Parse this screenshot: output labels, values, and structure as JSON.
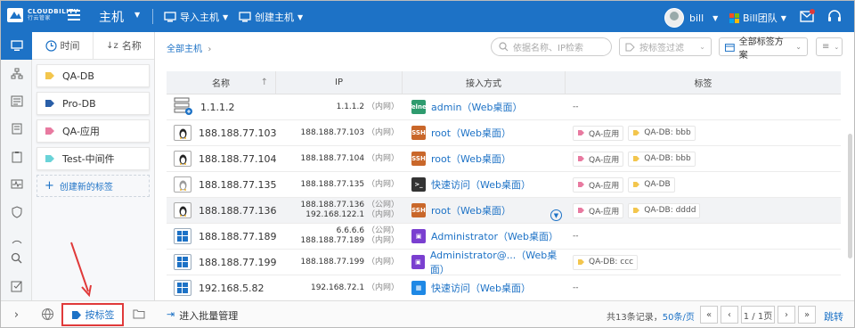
{
  "brand": {
    "name": "CLOUDBILITY",
    "sub": "行云管家"
  },
  "topbar": {
    "title": "主机",
    "import": "导入主机",
    "create": "创建主机",
    "user": "bill",
    "team": "Bill团队"
  },
  "colors": {
    "primary": "#1d72c6",
    "red": "#e03a3a"
  },
  "tagpanel": {
    "sort_time": "时间",
    "sort_name": "名称",
    "new_tag": "创建新的标签",
    "tags": [
      {
        "label": "QA-DB",
        "color": "#f3c64d"
      },
      {
        "label": "Pro-DB",
        "color": "#2a5fa8"
      },
      {
        "label": "QA-应用",
        "color": "#e87aa0"
      },
      {
        "label": "Test-中间件",
        "color": "#6ad3d8"
      }
    ]
  },
  "main": {
    "breadcrumb": "全部主机",
    "search_placeholder": "依据名称、IP检索",
    "tag_filter": "按标签过滤",
    "tag_scheme": "全部标签方案",
    "columns": {
      "name": "名称",
      "ip": "IP",
      "access": "接入方式",
      "tags": "标签"
    },
    "rows": [
      {
        "name": "1.1.1.2",
        "os": "server",
        "ips": [
          {
            "ip": "1.1.1.2",
            "net": "（内网）"
          }
        ],
        "acc_icon": "Telnet",
        "acc_color": "#2e9b6e",
        "access": "admin（Web桌面）",
        "tags": [],
        "empty": "--"
      },
      {
        "name": "188.188.77.103",
        "os": "linux",
        "ips": [
          {
            "ip": "188.188.77.103",
            "net": "（内网）"
          }
        ],
        "acc_icon": "SSH",
        "acc_color": "#c9672a",
        "access": "root（Web桌面）",
        "tags": [
          "QA-应用",
          "QA-DB: bbb"
        ]
      },
      {
        "name": "188.188.77.104",
        "os": "linux",
        "ips": [
          {
            "ip": "188.188.77.104",
            "net": "（内网）"
          }
        ],
        "acc_icon": "SSH",
        "acc_color": "#c9672a",
        "access": "root（Web桌面）",
        "tags": [
          "QA-应用",
          "QA-DB: bbb"
        ]
      },
      {
        "name": "188.188.77.135",
        "os": "linux-grey",
        "ips": [
          {
            "ip": "188.188.77.135",
            "net": "（内网）"
          }
        ],
        "acc_icon": ">_",
        "acc_color": "#333",
        "access": "快速访问（Web桌面）",
        "tags": [
          "QA-应用",
          "QA-DB"
        ]
      },
      {
        "name": "188.188.77.136",
        "os": "linux",
        "ips": [
          {
            "ip": "188.188.77.136",
            "net": "（公网）"
          },
          {
            "ip": "192.168.122.1",
            "net": "（内网）"
          }
        ],
        "acc_icon": "SSH",
        "acc_color": "#c9672a",
        "access": "root（Web桌面）",
        "tags": [
          "QA-应用",
          "QA-DB: dddd"
        ]
      },
      {
        "name": "188.188.77.189",
        "os": "windows",
        "ips": [
          {
            "ip": "6.6.6.6",
            "net": "（公网）"
          },
          {
            "ip": "188.188.77.189",
            "net": "（内网）"
          }
        ],
        "acc_icon": "RDP",
        "acc_color": "#7a3fd0",
        "access": "Administrator（Web桌面）",
        "tags": [],
        "empty": "--"
      },
      {
        "name": "188.188.77.199",
        "os": "windows",
        "ips": [
          {
            "ip": "188.188.77.199",
            "net": "（内网）"
          }
        ],
        "acc_icon": "RDP",
        "acc_color": "#7a3fd0",
        "access": "Administrator@...（Web桌面）",
        "tags": [
          "QA-DB: ccc"
        ]
      },
      {
        "name": "192.168.5.82",
        "os": "windows",
        "ips": [
          {
            "ip": "192.168.72.1",
            "net": "（内网）"
          }
        ],
        "acc_icon": "WIN",
        "acc_color": "#1e88e5",
        "access": "快速访问（Web桌面）",
        "tags": [],
        "empty": "--"
      }
    ]
  },
  "bottom": {
    "bytag": "按标签",
    "batch": "进入批量管理",
    "total": "共13条记录，",
    "per_page": "50条/页",
    "page": "1 / 1页",
    "jump": "跳转"
  }
}
